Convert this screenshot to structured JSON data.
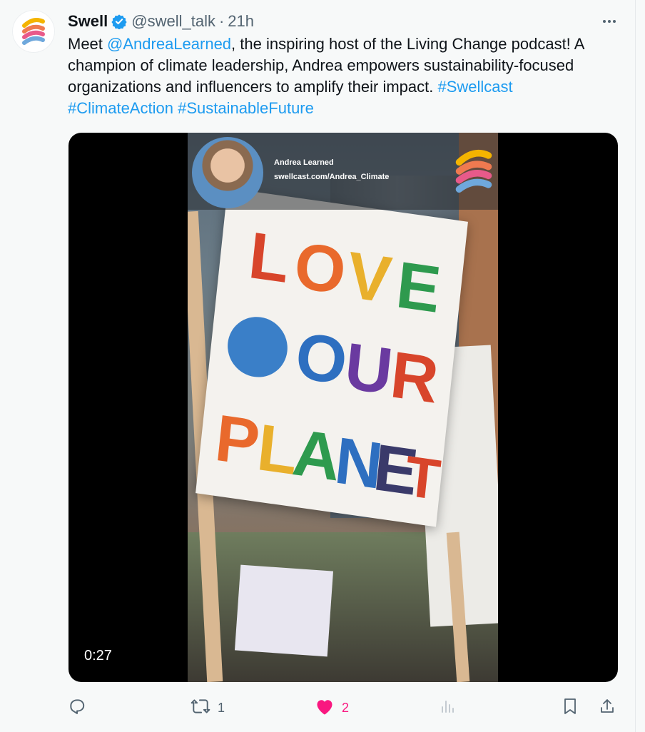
{
  "tweet": {
    "author_name": "Swell",
    "handle": "@swell_talk",
    "separator": "·",
    "time": "21h",
    "text_parts": {
      "p1": "Meet ",
      "mention": "@AndreaLearned",
      "p2": ", the inspiring host of the Living Change podcast!  A champion of climate leadership, Andrea empowers sustainability-focused organizations and influencers to amplify their impact. ",
      "hashtag1": "#Swellcast",
      "hashtag2": "#ClimateAction",
      "hashtag3": "#SustainableFuture"
    }
  },
  "media": {
    "overlay_name": "Andrea Learned",
    "overlay_url": "swellcast.com/Andrea_Climate",
    "sign_lines": [
      "LOVE",
      "OUR",
      "PLANET"
    ],
    "duration": "0:27"
  },
  "actions": {
    "reply_count": "",
    "retweet_count": "1",
    "like_count": "2",
    "views_count": ""
  },
  "colors": {
    "link": "#1d9bf0",
    "like": "#f91880",
    "verified": "#1d9bf0"
  },
  "icons": [
    "swell-logo-icon",
    "verified-badge-icon",
    "more-icon",
    "reply-icon",
    "retweet-icon",
    "like-icon",
    "views-icon",
    "bookmark-icon",
    "share-icon"
  ]
}
